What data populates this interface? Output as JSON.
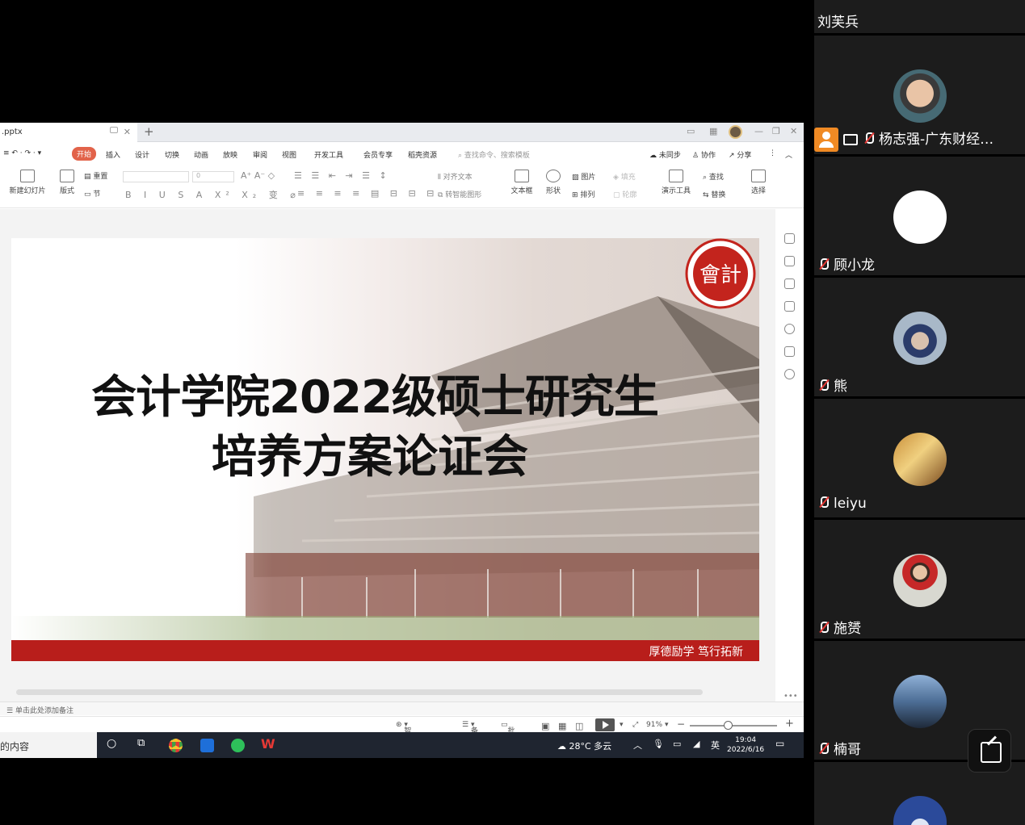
{
  "window": {
    "tab_name": ".pptx",
    "user_avatar": "user-avatar"
  },
  "menu": {
    "items": [
      "开始",
      "插入",
      "设计",
      "切换",
      "动画",
      "放映",
      "审阅",
      "视图",
      "开发工具",
      "会员专享",
      "稻壳资源"
    ],
    "search_placeholder": "查找命令、搜索模板",
    "sync": "未同步",
    "collab": "协作",
    "share": "分享"
  },
  "ribbon": {
    "new_slide": "新建幻灯片",
    "layout": "版式",
    "reset": "重置",
    "section": "节",
    "font_size": "0",
    "text_box": "文本框",
    "shape": "形状",
    "picture": "图片",
    "arrange": "排列",
    "present_tool": "演示工具",
    "find": "查找",
    "replace": "替换",
    "select": "选择",
    "align_text": "对齐文本",
    "smart_shape": "转智能图形",
    "outline": "轮廓",
    "fill": "填充"
  },
  "slide": {
    "title_line1": "会计学院2022级硕士研究生",
    "title_line2": "培养方案论证会",
    "motto": "厚德励学  笃行拓新",
    "logo_text": "會計",
    "brand_red": "#b81e1b"
  },
  "notes_placeholder": "单击此处添加备注",
  "statusbar": {
    "beautify": "智能美化",
    "notes": "备注",
    "comments": "批注",
    "zoom": "91%"
  },
  "taskbar": {
    "search_text": "的内容",
    "weather": "28°C  多云",
    "ime": "英",
    "time": "19:04",
    "date": "2022/6/16"
  },
  "participants": [
    {
      "name": "刘芙兵",
      "avatar": "none"
    },
    {
      "name": "杨志强-广东财经…",
      "avatar": "man-glasses",
      "host": true
    },
    {
      "name": "顾小龙",
      "avatar": "white-circle"
    },
    {
      "name": "熊",
      "avatar": "child-mask"
    },
    {
      "name": "leiyu",
      "avatar": "gold-plaque"
    },
    {
      "name": "施赟",
      "avatar": "child-red"
    },
    {
      "name": "楠哥",
      "avatar": "statue"
    }
  ]
}
